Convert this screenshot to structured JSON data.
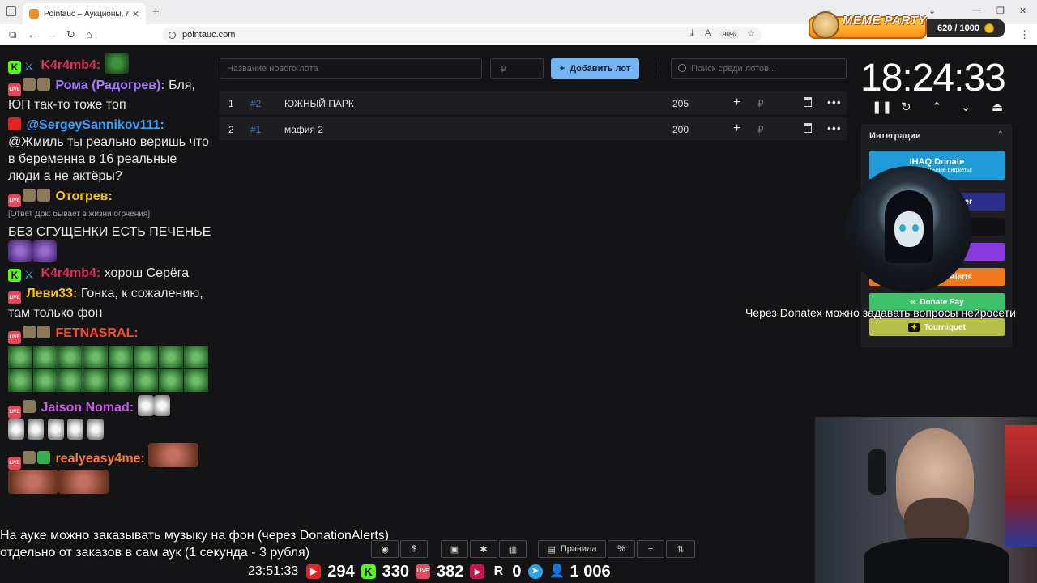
{
  "browser": {
    "tab_title": "Pointauc – Аукционы, лотереи",
    "url": "pointauc.com",
    "zoom": "90%"
  },
  "overlay": {
    "meme_title": "MEME PARTY",
    "meme_counter": "620 / 1000"
  },
  "chat": [
    {
      "nick": "K4r4mb4:",
      "nick_color": "#e0305a",
      "text": ""
    },
    {
      "nick": "Рома (Радогрев):",
      "nick_color": "#a77bff",
      "text": "Бля, ЮП так-то тоже топ"
    },
    {
      "nick": "@SergeySannikov111:",
      "nick_color": "#3aa0ff",
      "text": "@Жмиль ты реально веришь что в беременна в 16 реальные люди а не актёры?"
    },
    {
      "nick": "Отогрев:",
      "nick_color": "#f2c21a",
      "reply": "[Ответ Док: бывает в жизни огрчения]",
      "text": "БЕЗ СГУЩЕНКИ ЕСТЬ ПЕЧЕНЬЕ"
    },
    {
      "nick": "K4r4mb4:",
      "nick_color": "#e0305a",
      "text": "хорош Серёга"
    },
    {
      "nick": "Леви33:",
      "nick_color": "#f2c21a",
      "text": "Гонка, к сожалению, там только фон"
    },
    {
      "nick": "FETNASRAL:",
      "nick_color": "#ff4a2a",
      "text": ""
    },
    {
      "nick": "Jaison Nomad:",
      "nick_color": "#c85ae0",
      "text": ""
    },
    {
      "nick": "realyeasy4me:",
      "nick_color": "#ff7a30",
      "text": ""
    }
  ],
  "auction": {
    "new_lot_placeholder": "Название нового лота",
    "price_placeholder": "₽",
    "add_button": "Добавить лот",
    "search_placeholder": "Поиск среди лотов...",
    "lots": [
      {
        "num": "1",
        "id": "#2",
        "name": "ЮЖНЫЙ ПАРК",
        "amount": "205",
        "currency": "₽"
      },
      {
        "num": "2",
        "id": "#1",
        "name": "мафия 2",
        "amount": "200",
        "currency": "₽"
      }
    ]
  },
  "timer": {
    "time": "18:24:33"
  },
  "integrations": {
    "title": "Интеграции",
    "services": [
      {
        "label": "IHAQ Donate",
        "color": "#1d9bd7"
      },
      {
        "label": "...er",
        "color": "#2b2f8a"
      },
      {
        "label": "",
        "color": "#111115"
      },
      {
        "label": "",
        "color": "#8a3ae0"
      },
      {
        "label": "...Alerts",
        "color": "#f07a1a"
      },
      {
        "label": "Donate Pay",
        "color": "#3cc36a"
      },
      {
        "label": "Tourniquet",
        "color": "#b7c14a"
      }
    ],
    "ihaq_sub": "Ко... уникальные виджеты!"
  },
  "marquee": "Через Donatex можно задавать вопросы нейросети",
  "captions": {
    "line1": "На ауке можно заказывать музыку на фон (через DonationAlerts)",
    "line2": "отдельно от заказов в сам аук (1 секунда - 3 рубля)"
  },
  "toolbar": {
    "rules_label": "Правила"
  },
  "stats": {
    "time": "23:51:33",
    "youtube": "294",
    "kick": "330",
    "live": "382",
    "rutube": "0",
    "viewers": "1 006"
  }
}
